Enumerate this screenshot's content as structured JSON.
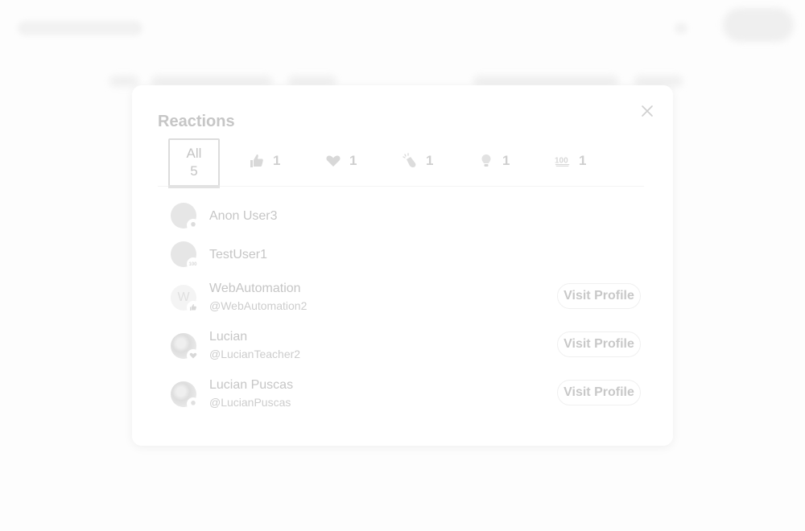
{
  "modal": {
    "title": "Reactions",
    "close_icon": "close-icon"
  },
  "tabs": [
    {
      "label": "All",
      "count": "5",
      "icon": null,
      "selected": true
    },
    {
      "label": "",
      "count": "1",
      "icon": "thumbs-up-icon",
      "selected": false
    },
    {
      "label": "",
      "count": "1",
      "icon": "heart-icon",
      "selected": false
    },
    {
      "label": "",
      "count": "1",
      "icon": "clapping-hands-icon",
      "selected": false
    },
    {
      "label": "",
      "count": "1",
      "icon": "lightbulb-icon",
      "selected": false
    },
    {
      "label": "",
      "count": "1",
      "icon": "hundred-points-icon",
      "selected": false
    }
  ],
  "users": [
    {
      "name": "Anon User3",
      "handle": "",
      "reaction": "lightbulb-icon",
      "avatar": "default-avatar",
      "visit_label": ""
    },
    {
      "name": "TestUser1",
      "handle": "",
      "reaction": "hundred-points-icon",
      "avatar": "default-avatar",
      "visit_label": ""
    },
    {
      "name": "WebAutomation",
      "handle": "@WebAutomation2",
      "reaction": "thumbs-up-icon",
      "avatar": "W",
      "visit_label": "Visit Profile"
    },
    {
      "name": "Lucian",
      "handle": "@LucianTeacher2",
      "reaction": "heart-icon",
      "avatar": "photo",
      "visit_label": "Visit Profile"
    },
    {
      "name": "Lucian Puscas",
      "handle": "@LucianPuscas",
      "reaction": "lightbulb-icon",
      "avatar": "photo",
      "visit_label": "Visit Profile"
    }
  ],
  "colors": {
    "text": "#c6c6c6",
    "modal_bg": "#ffffff",
    "page_bg": "#fdfdfd"
  }
}
